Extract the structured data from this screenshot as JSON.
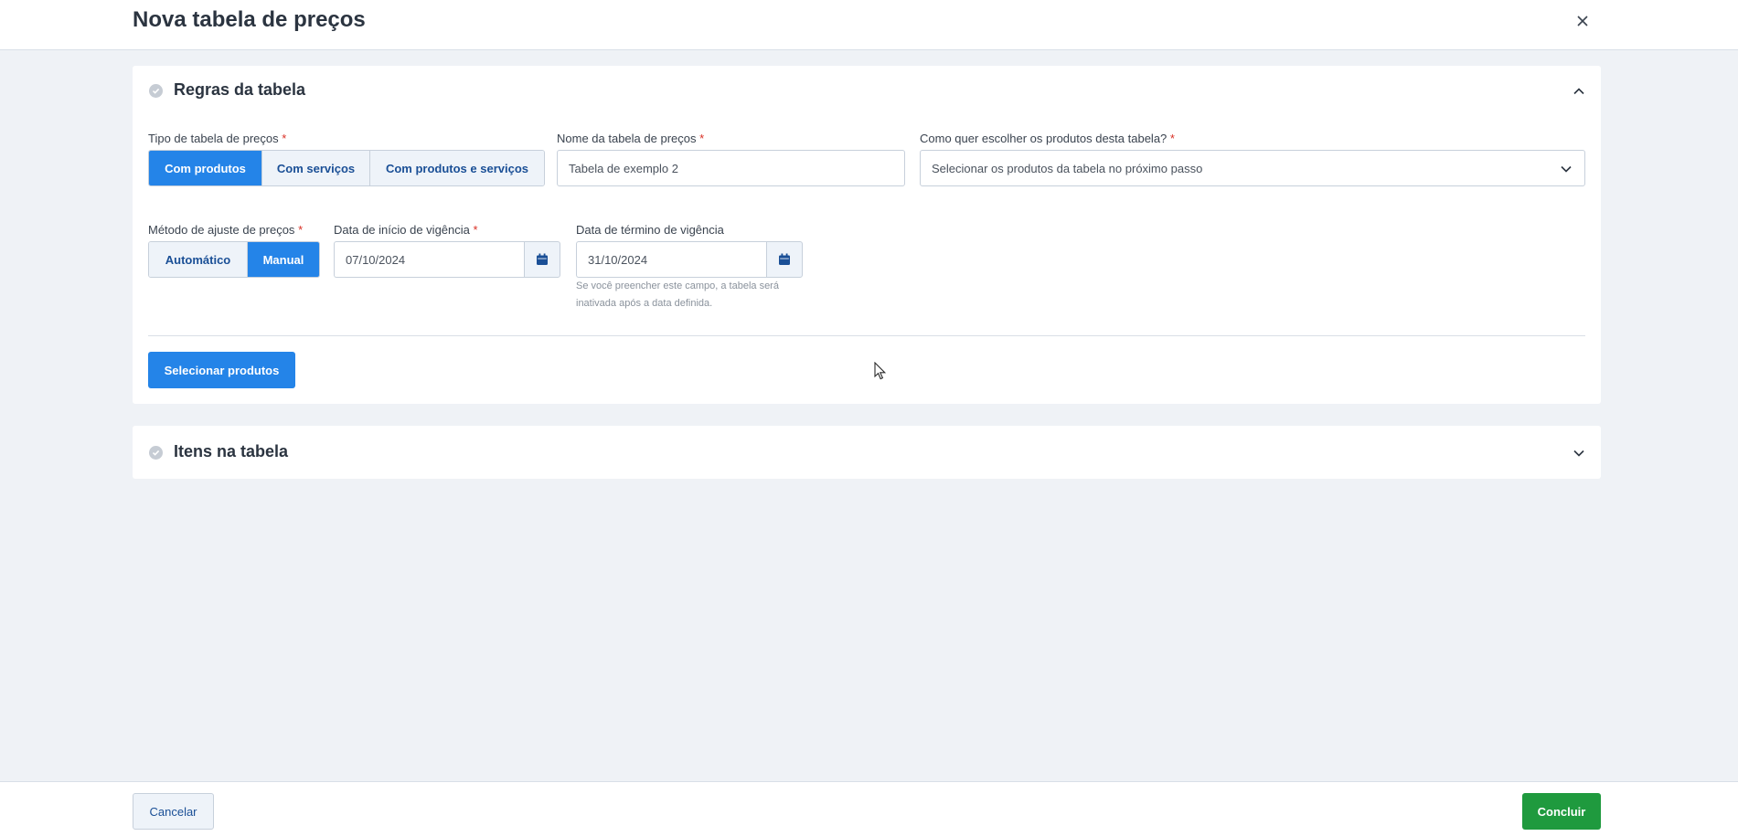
{
  "header": {
    "title": "Nova tabela de preços"
  },
  "rules_section": {
    "title": "Regras da tabela",
    "price_table_type": {
      "label": "Tipo de tabela de preços",
      "required_mark": "*",
      "options": [
        "Com produtos",
        "Com serviços",
        "Com produtos e serviços"
      ],
      "selected": "Com produtos"
    },
    "table_name": {
      "label": "Nome da tabela de preços",
      "required_mark": "*",
      "value": "Tabela de exemplo 2"
    },
    "product_choice": {
      "label": "Como quer escolher os produtos desta tabela?",
      "required_mark": "*",
      "value": "Selecionar os produtos da tabela no próximo passo"
    },
    "adjust_method": {
      "label": "Método de ajuste de preços",
      "required_mark": "*",
      "options": [
        "Automático",
        "Manual"
      ],
      "selected": "Manual"
    },
    "start_date": {
      "label": "Data de início de vigência",
      "required_mark": "*",
      "value": "07/10/2024"
    },
    "end_date": {
      "label": "Data de término de vigência",
      "value": "31/10/2024",
      "hint": "Se você preencher este campo, a tabela será inativada após a data definida."
    },
    "select_products_label": "Selecionar produtos"
  },
  "items_section": {
    "title": "Itens na tabela"
  },
  "footer": {
    "cancel_label": "Cancelar",
    "done_label": "Concluir"
  },
  "colors": {
    "primary": "#2484e8",
    "success": "#1f9a3e",
    "background": "#eff2f6",
    "required": "#d93025"
  },
  "icons": [
    "close-icon",
    "check-circle-icon",
    "chevron-up-icon",
    "chevron-down-icon",
    "calendar-icon",
    "mouse-cursor-icon"
  ]
}
